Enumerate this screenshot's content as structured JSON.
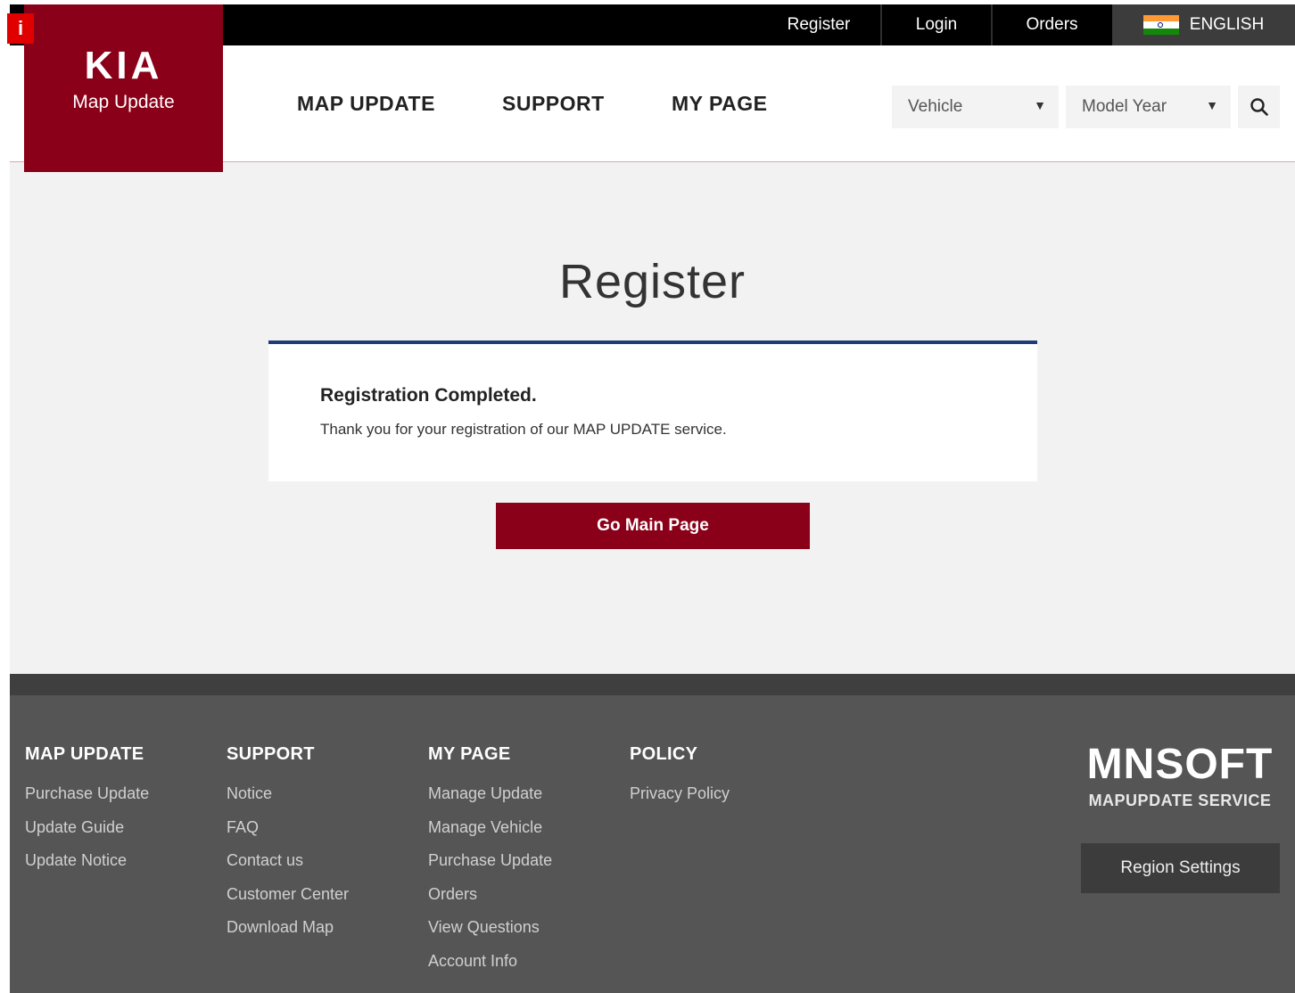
{
  "topbar": {
    "register": "Register",
    "login": "Login",
    "orders": "Orders",
    "language": "ENGLISH"
  },
  "badge": "i",
  "logo": {
    "brand": "KIA",
    "subtitle": "Map Update"
  },
  "nav": {
    "map_update": "MAP UPDATE",
    "support": "SUPPORT",
    "my_page": "MY PAGE"
  },
  "filters": {
    "vehicle": "Vehicle",
    "model_year": "Model Year",
    "arrow": "▼"
  },
  "main": {
    "title": "Register",
    "heading": "Registration Completed.",
    "message": "Thank you for your registration of our MAP UPDATE service.",
    "button": "Go Main Page"
  },
  "footer": {
    "columns": [
      {
        "title": "MAP UPDATE",
        "links": [
          "Purchase Update",
          "Update Guide",
          "Update Notice"
        ]
      },
      {
        "title": "SUPPORT",
        "links": [
          "Notice",
          "FAQ",
          "Contact us",
          "Customer Center",
          "Download Map"
        ]
      },
      {
        "title": "MY PAGE",
        "links": [
          "Manage Update",
          "Manage Vehicle",
          "Purchase Update",
          "Orders",
          "View Questions",
          "Account Info"
        ]
      },
      {
        "title": "POLICY",
        "links": [
          "Privacy Policy"
        ]
      }
    ],
    "brand": "MNSOFT",
    "brand_sub": "MAPUPDATE SERVICE",
    "region_button": "Region Settings"
  },
  "colors": {
    "brand": "#8b0019",
    "card_border": "#1e3c78",
    "footer_bg": "#555555"
  },
  "icons": {
    "language_flag": "india-flag-icon",
    "search": "search-icon"
  }
}
